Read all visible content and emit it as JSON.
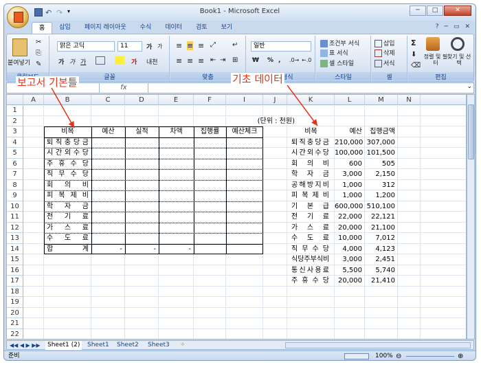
{
  "window": {
    "title": "Book1 - Microsoft Excel",
    "minimize": "─",
    "maximize": "□",
    "close": "✕"
  },
  "tabs": [
    "홈",
    "삽입",
    "페이지 레이아웃",
    "수식",
    "데이터",
    "검토",
    "보기"
  ],
  "ribbon": {
    "clipboard": {
      "paste": "붙여넣기",
      "label": "클립보드"
    },
    "font": {
      "name": "맑은 고딕",
      "size": "11",
      "grow": "가",
      "shrink": "가",
      "bold": "가",
      "italic": "가",
      "underline": "가",
      "fontcolor": "가",
      "phonetic": "내천",
      "label": "글꼴"
    },
    "align": {
      "label": "맞춤"
    },
    "number": {
      "format": "일반",
      "currency": "₩",
      "percent": "%",
      "comma": ",",
      "label": "표시 형식"
    },
    "styles": {
      "cond": "조건부 서식",
      "table": "표 서식",
      "cell": "셀 스타일",
      "label": "스타일"
    },
    "cells": {
      "insert": "삽입",
      "delete": "삭제",
      "format": "서식",
      "label": "셀"
    },
    "edit": {
      "sum": "Σ",
      "sort": "정렬 및 필터",
      "find": "찾기 및 선택",
      "label": "편집"
    }
  },
  "formula_bar": {
    "fx": "fx",
    "value": ""
  },
  "annotations": {
    "left": "보고서 기본틀",
    "right": "기초 데이터"
  },
  "columns": [
    "A",
    "B",
    "C",
    "D",
    "E",
    "F",
    "I",
    "J",
    "K",
    "L",
    "M",
    "N"
  ],
  "rows": [
    "1",
    "2",
    "3",
    "4",
    "5",
    "6",
    "7",
    "8",
    "9",
    "10",
    "11",
    "12",
    "13",
    "14",
    "15",
    "16",
    "17",
    "18",
    "19",
    "20",
    "21",
    "22"
  ],
  "report": {
    "unit": "(단위 : 천원)",
    "headers": [
      "비목",
      "예산",
      "실적",
      "차액",
      "집행률",
      "예산체크"
    ],
    "items": [
      "퇴직충당금",
      "시간외수당",
      "주휴수당",
      "직무수당",
      "회의비",
      "피복제비",
      "학자금",
      "전기료",
      "가스료",
      "수도료",
      "합계"
    ],
    "total_values": [
      "-",
      "-",
      "-"
    ]
  },
  "data": {
    "headers": [
      "비목",
      "예산",
      "집행금액"
    ],
    "rows": [
      [
        "퇴직충당금",
        "210,000",
        "307,000"
      ],
      [
        "시간외수당",
        "100,000",
        "101,500"
      ],
      [
        "회의비",
        "600",
        "505"
      ],
      [
        "학자금",
        "3,000",
        "2,150"
      ],
      [
        "공해방지비",
        "1,000",
        "312"
      ],
      [
        "피복제비",
        "1,000",
        "1,200"
      ],
      [
        "기본급",
        "600,000",
        "510,100"
      ],
      [
        "전기료",
        "22,000",
        "22,121"
      ],
      [
        "가스료",
        "20,000",
        "21,100"
      ],
      [
        "수도료",
        "10,000",
        "7,012"
      ],
      [
        "직무수당",
        "4,000",
        "4,123"
      ],
      [
        "식당주부식비",
        "3,000",
        "2,451"
      ],
      [
        "통신사용료",
        "5,500",
        "5,740"
      ],
      [
        "주휴수당",
        "20,000",
        "21,410"
      ]
    ]
  },
  "sheets": [
    "Sheet1 (2)",
    "Sheet1",
    "Sheet2",
    "Sheet3"
  ],
  "status": {
    "ready": "준비",
    "zoom": "100%"
  }
}
